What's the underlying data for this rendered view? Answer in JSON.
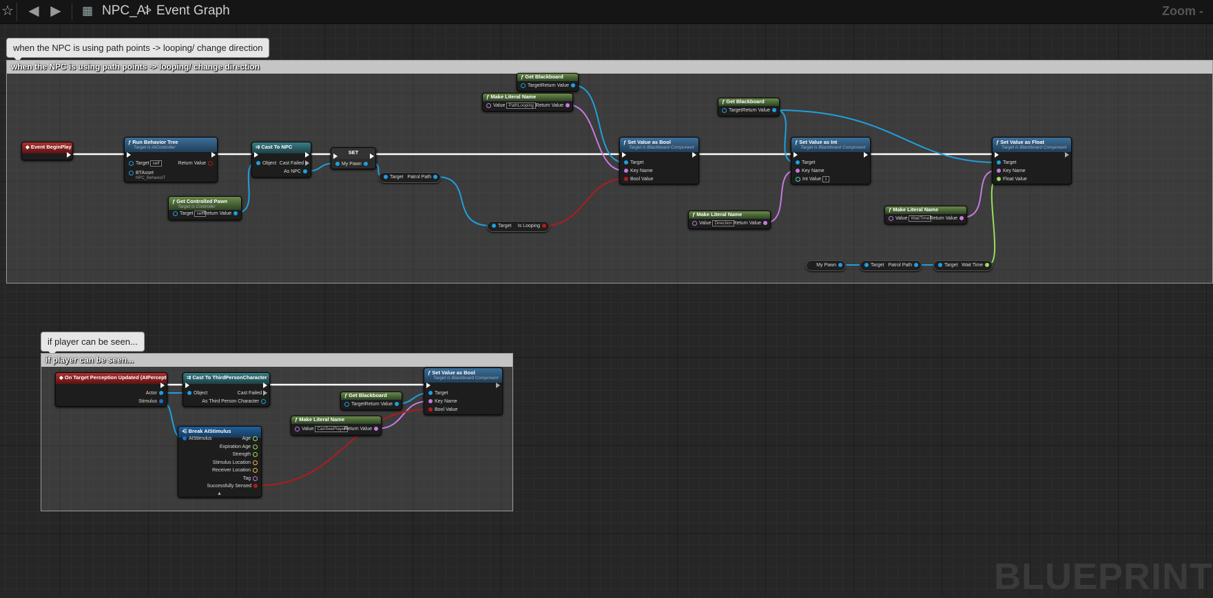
{
  "topbar": {
    "icons": [
      "star-icon",
      "back-arrow-icon",
      "forward-arrow-icon",
      "blueprint-icon"
    ],
    "breadcrumb_asset": "NPC_AI",
    "breadcrumb_separator": ">",
    "breadcrumb_graph": "Event Graph",
    "zoom": "Zoom -"
  },
  "watermark": "BLUEPRINT",
  "comment1": {
    "bubble": "when the NPC is using path points -> looping/ change direction",
    "title": "when the NPC is using path points -> looping/ change direction"
  },
  "comment2": {
    "bubble": "if player can be seen...",
    "title": "if player can be seen..."
  },
  "nodes": {
    "begin_play": {
      "title": "Event BeginPlay"
    },
    "run_bt": {
      "title": "Run Behavior Tree",
      "subtitle": "Target is AIController",
      "target": "Target",
      "self": "self",
      "btasset": "BTAsset",
      "btasset_value": "NPC_BehaviorT",
      "return": "Return Value"
    },
    "get_pawn": {
      "title": "Get Controlled Pawn",
      "subtitle": "Target is Controller",
      "target": "Target",
      "self": "self",
      "return": "Return Value"
    },
    "cast_npc": {
      "title": "Cast To NPC",
      "object": "Object",
      "failed": "Cast Failed",
      "as": "As NPC"
    },
    "set_pawn": {
      "title": "SET",
      "var": "My Pawn"
    },
    "patrol_path1": {
      "target": "Target",
      "out": "Patrol Path"
    },
    "is_looping": {
      "target": "Target",
      "out": "Is Looping"
    },
    "get_bb1": {
      "title": "Get Blackboard",
      "target": "Target",
      "return": "Return Value"
    },
    "lit_name1": {
      "title": "Make Literal Name",
      "value_label": "Value",
      "value": "PathLooping",
      "return": "Return Value"
    },
    "set_bool1": {
      "title": "Set Value as Bool",
      "subtitle": "Target is Blackboard Component",
      "target": "Target",
      "key": "Key Name",
      "bool": "Bool Value"
    },
    "get_bb2": {
      "title": "Get Blackboard",
      "target": "Target",
      "return": "Return Value"
    },
    "set_int": {
      "title": "Set Value as Int",
      "subtitle": "Target is Blackboard Component",
      "target": "Target",
      "key": "Key Name",
      "int": "Int Value",
      "int_value": "1"
    },
    "lit_name2": {
      "title": "Make Literal Name",
      "value_label": "Value",
      "value": "Direction",
      "return": "Return Value"
    },
    "set_float": {
      "title": "Set Value as Float",
      "subtitle": "Target is Blackboard Component",
      "target": "Target",
      "key": "Key Name",
      "float": "Float Value"
    },
    "lit_name3": {
      "title": "Make Literal Name",
      "value_label": "Value",
      "value": "WaitTime",
      "return": "Return Value"
    },
    "my_pawn2": {
      "out": "My Pawn"
    },
    "patrol_path2": {
      "target": "Target",
      "out": "Patrol Path"
    },
    "wait_time": {
      "target": "Target",
      "out": "Wait Time"
    },
    "perception": {
      "title": "On Target Perception Updated (AIPerception)",
      "actor": "Actor",
      "stimulus": "Stimulus"
    },
    "cast_tpc": {
      "title": "Cast To ThirdPersonCharacter",
      "object": "Object",
      "failed": "Cast Failed",
      "as": "As Third Person Character"
    },
    "break_stim": {
      "title": "Break AIStimulus",
      "in": "AIStimulus",
      "outs": [
        "Age",
        "Expiration Age",
        "Strength",
        "Stimulus Location",
        "Receiver Location",
        "Tag",
        "Successfully Sensed"
      ]
    },
    "get_bb3": {
      "title": "Get Blackboard",
      "target": "Target",
      "return": "Return Value"
    },
    "lit_name4": {
      "title": "Make Literal Name",
      "value_label": "Value",
      "value": "CanSeePlayer",
      "return": "Return Value"
    },
    "set_bool2": {
      "title": "Set Value as Bool",
      "subtitle": "Target is Blackboard Component",
      "target": "Target",
      "key": "Key Name",
      "bool": "Bool Value"
    }
  },
  "colors": {
    "exec": "#ffffff",
    "object": "#1da1e0",
    "name": "#c77ae3",
    "bool": "#b21b1b",
    "float": "#9be05a",
    "int": "#4fe0a8",
    "vector": "#f0c03a",
    "struct": "#1a6fc4"
  }
}
